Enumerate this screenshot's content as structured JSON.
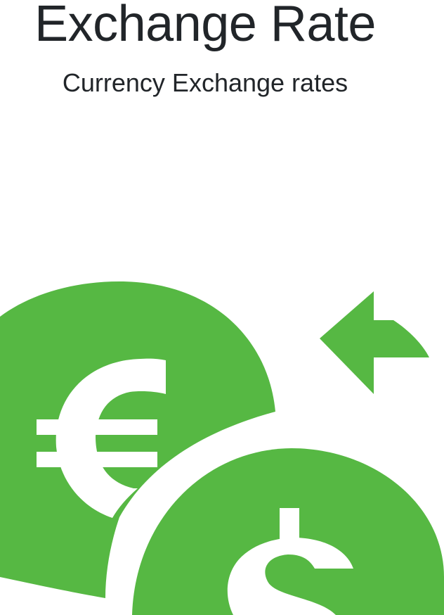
{
  "header": {
    "title": "Exchange Rate",
    "subtitle": "Currency Exchange rates"
  },
  "hero": {
    "icon": "currency-exchange-icon",
    "accent_color": "#56b843"
  }
}
